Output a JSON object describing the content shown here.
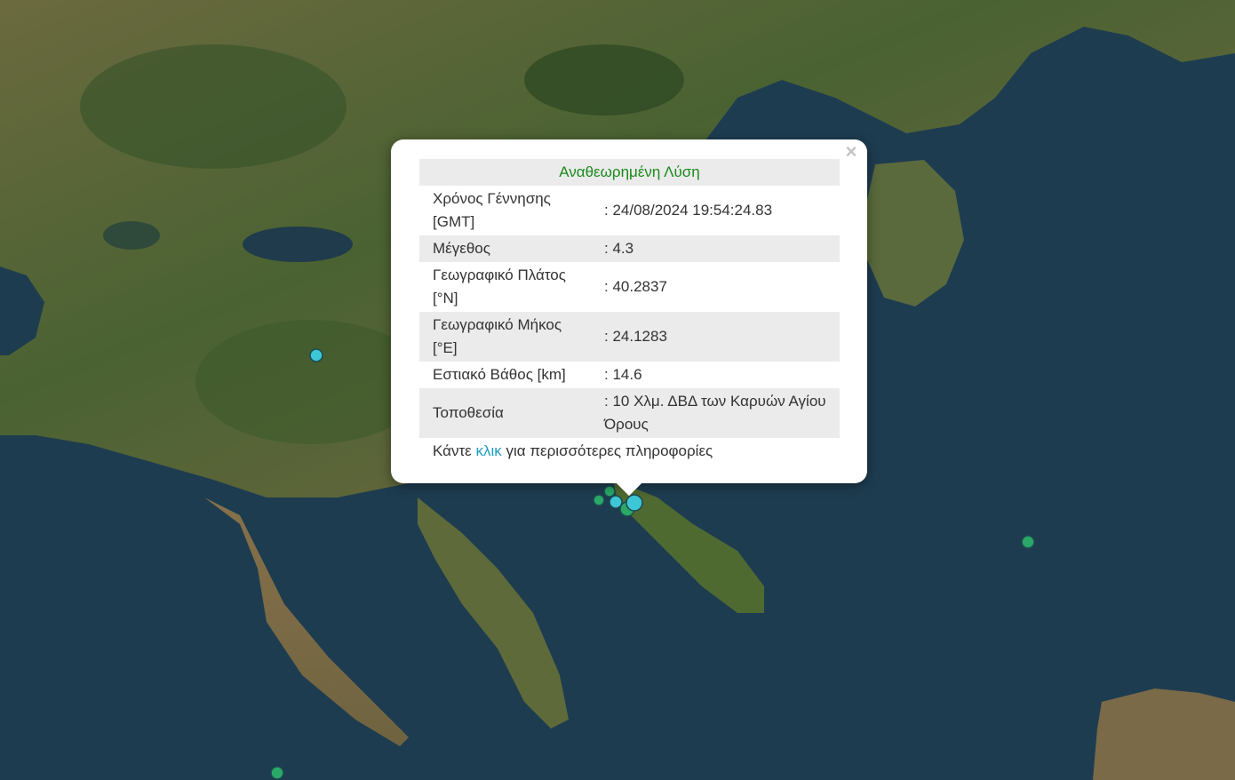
{
  "popup": {
    "header": "Αναθεωρημένη Λύση",
    "close_symbol": "×",
    "rows": [
      {
        "label": "Χρόνος Γέννησης [GMT]",
        "value": ": 24/08/2024 19:54:24.83"
      },
      {
        "label": "Μέγεθος",
        "value": ": 4.3"
      },
      {
        "label": "Γεωγραφικό Πλάτος [°N]",
        "value": ": 40.2837"
      },
      {
        "label": "Γεωγραφικό Μήκος [°E]",
        "value": ": 24.1283"
      },
      {
        "label": "Εστιακό Βάθος [km]",
        "value": ": 14.6"
      },
      {
        "label": "Τοποθεσία",
        "value": ": 10 Χλμ. ΔΒΔ των Καρυών Αγίου Όρους"
      }
    ],
    "more_prefix": "Κάντε ",
    "more_link": "κλικ",
    "more_suffix": " για περισσότερες πληροφορίες"
  },
  "map": {
    "colors": {
      "sea": "#1d3a4e",
      "land_green": "#3f5c2c",
      "land_brown": "#7d6a45",
      "marker_cyan": "#3cc6d6",
      "marker_green": "#2aa868",
      "marker_border": "#1c4a50"
    }
  }
}
